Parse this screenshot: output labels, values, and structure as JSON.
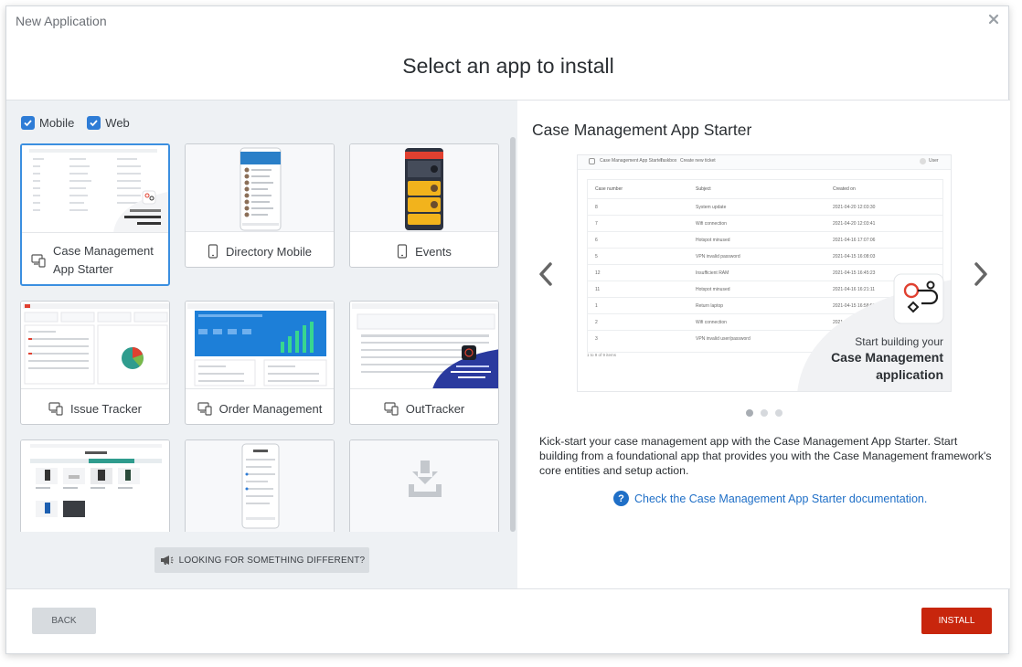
{
  "dialog": {
    "title": "New Application",
    "heading": "Select an app to install"
  },
  "filters": [
    {
      "label": "Mobile",
      "checked": true
    },
    {
      "label": "Web",
      "checked": true
    }
  ],
  "apps": [
    {
      "label": "Case Management App Starter",
      "label_line1": "Case Management",
      "label_line2": "App Starter",
      "icon": "web-mobile-icon",
      "selected": true
    },
    {
      "label": "Directory Mobile",
      "icon": "mobile-icon"
    },
    {
      "label": "Events",
      "icon": "mobile-icon"
    },
    {
      "label": "Issue Tracker",
      "icon": "web-mobile-icon"
    },
    {
      "label": "Order Management",
      "icon": "web-mobile-icon"
    },
    {
      "label": "OutTracker",
      "icon": "web-mobile-icon"
    }
  ],
  "looking_button": "LOOKING FOR SOMETHING DIFFERENT?",
  "detail": {
    "title": "Case Management App Starter",
    "preview": {
      "app_name": "Case Management App Starter",
      "nav1": "Taskbox",
      "nav2": "Create new ticket",
      "user": "User",
      "columns": [
        "Case number",
        "Subject",
        "Created on"
      ],
      "rows": [
        [
          "8",
          "System update",
          "2021-04-20 12:03:30"
        ],
        [
          "7",
          "Wifi connection",
          "2021-04-20 12:03:41"
        ],
        [
          "6",
          "Hotspot minused",
          "2021-04-16 17:07:06"
        ],
        [
          "5",
          "VPN invalid password",
          "2021-04-15 16:08:03"
        ],
        [
          "12",
          "Insufficient RAM",
          "2021-04-15 16:45:23"
        ],
        [
          "11",
          "Hotspot minused",
          "2021-04-16 16:21:11"
        ],
        [
          "1",
          "Return laptop",
          "2021-04-15 16:58:50"
        ],
        [
          "2",
          "Wifi connection",
          "2021-04-15 16:58:52"
        ],
        [
          "3",
          "VPN invalid user/password",
          "2021-04-15 16:58:54"
        ]
      ],
      "footer": "1 to 9 of 9 items",
      "promo_line1": "Start building your",
      "promo_line2": "Case Management",
      "promo_line3": "application"
    },
    "slide_count": 3,
    "active_slide": 0,
    "description": "Kick-start your case management app with the Case Management App Starter. Start building from a foundational app that provides you with the Case Management framework's core entities and setup action.",
    "doc_link": "Check the Case Management App Starter documentation."
  },
  "footer": {
    "back_label": "BACK",
    "install_label": "INSTALL"
  },
  "colors": {
    "accent": "#2e7cd6",
    "install": "#c8260d",
    "link": "#1f6fc7",
    "selected_border": "#3b8fe0"
  }
}
